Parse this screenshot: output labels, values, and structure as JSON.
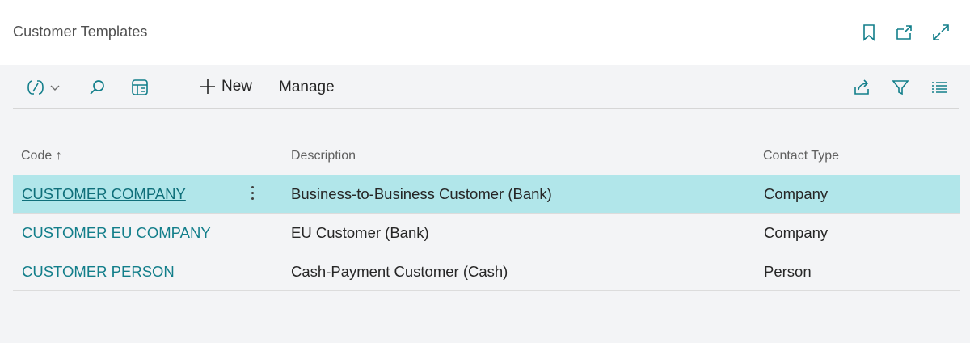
{
  "header": {
    "title": "Customer Templates",
    "icons": [
      "bookmark-icon",
      "open-new-window-icon",
      "expand-icon"
    ]
  },
  "toolbar": {
    "new_label": "New",
    "manage_label": "Manage",
    "icons": [
      "copilot-icon",
      "chevron-down-icon",
      "search-icon",
      "edit-list-icon",
      "share-icon",
      "filter-icon",
      "list-view-icon"
    ]
  },
  "table": {
    "columns": {
      "code": "Code",
      "code_sort": "↑",
      "description": "Description",
      "contact_type": "Contact Type"
    },
    "rows": [
      {
        "code": "CUSTOMER COMPANY",
        "description": "Business-to-Business Customer (Bank)",
        "contact_type": "Company",
        "selected": true
      },
      {
        "code": "CUSTOMER EU COMPANY",
        "description": "EU Customer (Bank)",
        "contact_type": "Company",
        "selected": false
      },
      {
        "code": "CUSTOMER PERSON",
        "description": "Cash-Payment Customer (Cash)",
        "contact_type": "Person",
        "selected": false
      }
    ]
  },
  "colors": {
    "accent": "#127e8a",
    "selected_row": "#b1e6ea",
    "background": "#f3f4f6"
  }
}
